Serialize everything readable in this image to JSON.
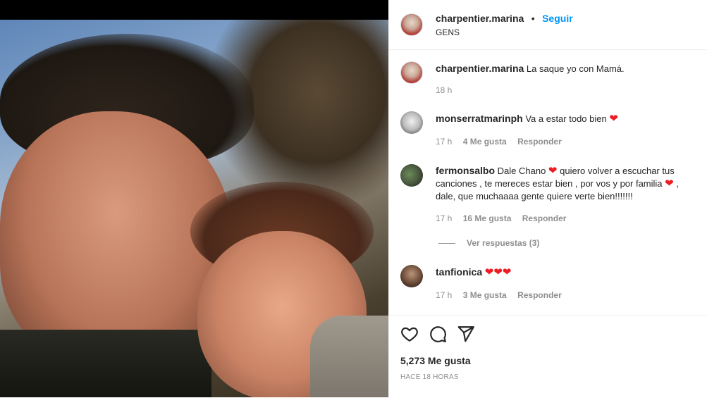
{
  "post": {
    "username": "charpentier.marina",
    "separator": "•",
    "follow_label": "Seguir",
    "location": "GENS"
  },
  "caption": {
    "username": "charpentier.marina",
    "text": "La saque yo con Mamá.",
    "time": "18 h"
  },
  "comments": [
    {
      "username": "monserratmarinph",
      "text": "Va a estar todo bien",
      "hearts": "❤",
      "time": "17 h",
      "likes": "4 Me gusta",
      "reply": "Responder"
    },
    {
      "username": "fermonsalbo",
      "text_1": "Dale Chano",
      "text_2": "quiero volver a escuchar tus canciones , te mereces estar bien , por vos y por familia",
      "text_3": ", dale, que muchaaaa gente quiere verte bien!!!!!!!",
      "heart": "❤",
      "time": "17 h",
      "likes": "16 Me gusta",
      "reply": "Responder",
      "view_replies": "Ver respuestas (3)"
    },
    {
      "username": "tanfionica",
      "hearts": "❤❤❤",
      "time": "17 h",
      "likes": "3 Me gusta",
      "reply": "Responder"
    }
  ],
  "footer": {
    "likes": "5,273 Me gusta",
    "time": "HACE 18 HORAS"
  },
  "icons": [
    "heart-icon",
    "comment-icon",
    "share-icon"
  ],
  "colors": {
    "accent": "#0095f6",
    "heart": "#ed1c24",
    "muted": "#8e8e8e"
  }
}
